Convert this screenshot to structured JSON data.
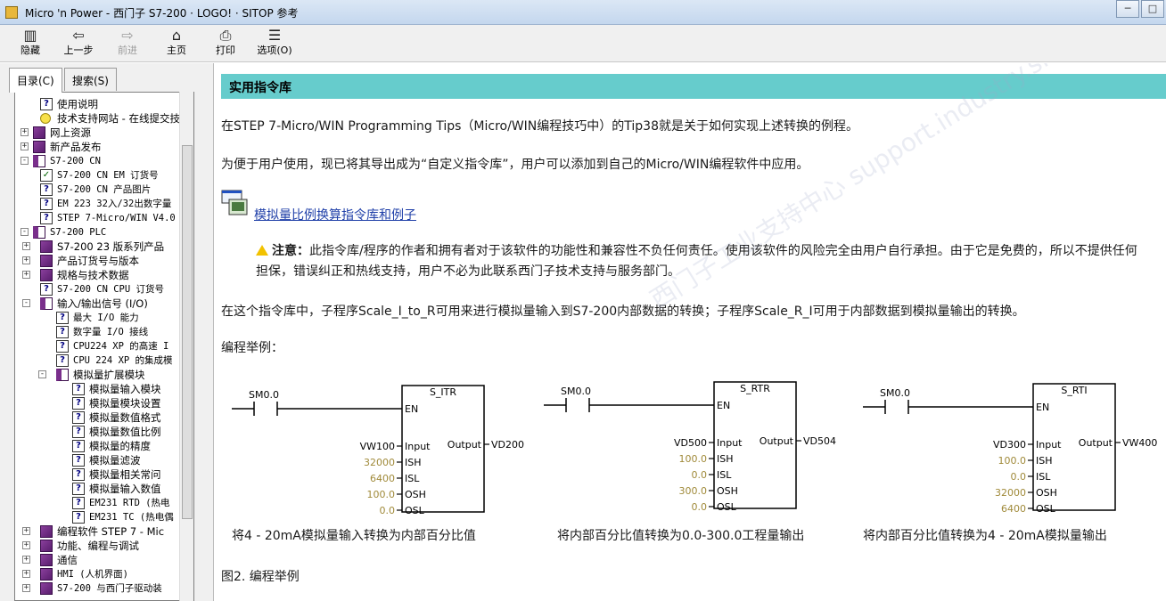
{
  "window": {
    "title": "Micro 'n Power - 西门子 S7-200 · LOGO! · SITOP 参考",
    "controls": [
      "minimize",
      "maximize"
    ]
  },
  "toolbar": {
    "buttons": [
      {
        "label": "隐藏",
        "icon": "hide-pane-icon",
        "enabled": true
      },
      {
        "label": "上一步",
        "icon": "back-arrow-icon",
        "enabled": true
      },
      {
        "label": "前进",
        "icon": "forward-arrow-icon",
        "enabled": false
      },
      {
        "label": "主页",
        "icon": "home-icon",
        "enabled": true
      },
      {
        "label": "打印",
        "icon": "printer-icon",
        "enabled": true
      },
      {
        "label": "选项(O)",
        "icon": "options-icon",
        "enabled": true
      }
    ]
  },
  "sidebar": {
    "tabs": [
      {
        "label": "目录(C)",
        "active": true
      },
      {
        "label": "搜索(S)",
        "active": false
      }
    ],
    "tree": [
      {
        "label": "使用说明",
        "icon": "page",
        "level": 1,
        "expander": "",
        "mono": false
      },
      {
        "label": "技术支持网站 - 在线提交技",
        "icon": "bulb",
        "level": 1,
        "expander": "",
        "mono": false
      },
      {
        "label": "网上资源",
        "icon": "book",
        "level": 0,
        "expander": "+",
        "mono": false
      },
      {
        "label": "新产品发布",
        "icon": "book",
        "level": 0,
        "expander": "+",
        "mono": false
      },
      {
        "label": "S7-200 CN",
        "icon": "bookopen",
        "level": 0,
        "expander": "-",
        "mono": true
      },
      {
        "label": "S7-200 CN EM 订货号",
        "icon": "check",
        "level": 1,
        "expander": "",
        "mono": true
      },
      {
        "label": "S7-200 CN 产品图片",
        "icon": "page",
        "level": 1,
        "expander": "",
        "mono": true
      },
      {
        "label": "EM 223 32入/32出数字量",
        "icon": "page",
        "level": 1,
        "expander": "",
        "mono": true
      },
      {
        "label": "STEP 7-Micro/WIN V4.0",
        "icon": "page",
        "level": 1,
        "expander": "",
        "mono": true
      },
      {
        "label": "S7-200 PLC",
        "icon": "bookopen",
        "level": 0,
        "expander": "-",
        "mono": true
      },
      {
        "label": "S7-200 23 版系列产品",
        "icon": "book",
        "level": 1,
        "expander": "+",
        "mono": false
      },
      {
        "label": "产品订货号与版本",
        "icon": "book",
        "level": 1,
        "expander": "+",
        "mono": false
      },
      {
        "label": "规格与技术数据",
        "icon": "book",
        "level": 1,
        "expander": "+",
        "mono": false
      },
      {
        "label": "S7-200 CN CPU 订货号",
        "icon": "page",
        "level": 1,
        "expander": "",
        "mono": true
      },
      {
        "label": "输入/输出信号 (I/O)",
        "icon": "bookopen",
        "level": 1,
        "expander": "-",
        "mono": false
      },
      {
        "label": "最大 I/O 能力",
        "icon": "page",
        "level": 2,
        "expander": "",
        "mono": true
      },
      {
        "label": "数字量 I/O 接线",
        "icon": "page",
        "level": 2,
        "expander": "",
        "mono": true
      },
      {
        "label": "CPU224 XP 的高速 I",
        "icon": "page",
        "level": 2,
        "expander": "",
        "mono": true
      },
      {
        "label": "CPU 224 XP 的集成模",
        "icon": "page",
        "level": 2,
        "expander": "",
        "mono": true
      },
      {
        "label": "模拟量扩展模块",
        "icon": "bookopen",
        "level": 2,
        "expander": "-",
        "mono": false
      },
      {
        "label": "模拟量输入模块",
        "icon": "page",
        "level": 3,
        "expander": "",
        "mono": false
      },
      {
        "label": "模拟量模块设置",
        "icon": "page",
        "level": 3,
        "expander": "",
        "mono": false
      },
      {
        "label": "模拟量数值格式",
        "icon": "page",
        "level": 3,
        "expander": "",
        "mono": false
      },
      {
        "label": "模拟量数值比例",
        "icon": "page",
        "level": 3,
        "expander": "",
        "mono": false
      },
      {
        "label": "模拟量的精度",
        "icon": "page",
        "level": 3,
        "expander": "",
        "mono": false
      },
      {
        "label": "模拟量滤波",
        "icon": "page",
        "level": 3,
        "expander": "",
        "mono": false
      },
      {
        "label": "模拟量相关常问",
        "icon": "page",
        "level": 3,
        "expander": "",
        "mono": false
      },
      {
        "label": "模拟量输入数值",
        "icon": "page",
        "level": 3,
        "expander": "",
        "mono": false
      },
      {
        "label": "EM231 RTD (热电",
        "icon": "page",
        "level": 3,
        "expander": "",
        "mono": true
      },
      {
        "label": "EM231 TC (热电偶",
        "icon": "page",
        "level": 3,
        "expander": "",
        "mono": true
      },
      {
        "label": "编程软件 STEP 7 - Mic",
        "icon": "book",
        "level": 1,
        "expander": "+",
        "mono": false
      },
      {
        "label": "功能、编程与调试",
        "icon": "book",
        "level": 1,
        "expander": "+",
        "mono": false
      },
      {
        "label": "通信",
        "icon": "book",
        "level": 1,
        "expander": "+",
        "mono": false
      },
      {
        "label": "HMI (人机界面)",
        "icon": "book",
        "level": 1,
        "expander": "+",
        "mono": true
      },
      {
        "label": "S7-200 与西门子驱动装",
        "icon": "book",
        "level": 1,
        "expander": "+",
        "mono": true
      }
    ]
  },
  "content": {
    "heading": "实用指令库",
    "para1": "在STEP 7-Micro/WIN Programming Tips（Micro/WIN编程技巧中）的Tip38就是关于如何实现上述转换的例程。",
    "para2": "为便于用户使用，现已将其导出成为“自定义指令库”，用户可以添加到自己的Micro/WIN编程软件中应用。",
    "link": "模拟量比例换算指令库和例子",
    "note_label": "注意：",
    "note_text": "此指令库/程序的作者和拥有者对于该软件的功能性和兼容性不负任何责任。使用该软件的风险完全由用户自行承担。由于它是免费的，所以不提供任何担保，错误纠正和热线支持，用户不必为此联系西门子技术支持与服务部门。",
    "para3": "在这个指令库中，子程序Scale_I_to_R可用来进行模拟量输入到S7-200内部数据的转换；子程序Scale_R_I可用于内部数据到模拟量输出的转换。",
    "para4": "编程举例：",
    "figure_caption": "图2. 编程举例",
    "watermark": "西门子工业支持中心 support.industry.siemens.com/cs"
  },
  "ladders": [
    {
      "contact": "SM0.0",
      "block": "S_ITR",
      "en": "EN",
      "output_pin": "Output",
      "output_value": "VD200",
      "inputs": [
        {
          "value": "VW100",
          "pin": "Input",
          "const": false
        },
        {
          "value": "32000",
          "pin": "ISH",
          "const": true
        },
        {
          "value": "6400",
          "pin": "ISL",
          "const": true
        },
        {
          "value": "100.0",
          "pin": "OSH",
          "const": true
        },
        {
          "value": "0.0",
          "pin": "OSL",
          "const": true
        }
      ],
      "caption": "将4 - 20mA模拟量输入转换为内部百分比值"
    },
    {
      "contact": "SM0.0",
      "block": "S_RTR",
      "en": "EN",
      "output_pin": "Output",
      "output_value": "VD504",
      "inputs": [
        {
          "value": "VD500",
          "pin": "Input",
          "const": false
        },
        {
          "value": "100.0",
          "pin": "ISH",
          "const": true
        },
        {
          "value": "0.0",
          "pin": "ISL",
          "const": true
        },
        {
          "value": "300.0",
          "pin": "OSH",
          "const": true
        },
        {
          "value": "0.0",
          "pin": "OSL",
          "const": true
        }
      ],
      "caption": "将内部百分比值转换为0.0-300.0工程量输出"
    },
    {
      "contact": "SM0.0",
      "block": "S_RTI",
      "en": "EN",
      "output_pin": "Output",
      "output_value": "VW400",
      "inputs": [
        {
          "value": "VD300",
          "pin": "Input",
          "const": false
        },
        {
          "value": "100.0",
          "pin": "ISH",
          "const": true
        },
        {
          "value": "0.0",
          "pin": "ISL",
          "const": true
        },
        {
          "value": "32000",
          "pin": "OSH",
          "const": true
        },
        {
          "value": "6400",
          "pin": "OSL",
          "const": true
        }
      ],
      "caption": "将内部百分比值转换为4 - 20mA模拟量输出"
    }
  ],
  "colors": {
    "heading_bar": "#66cccc",
    "link": "#1f3fa8",
    "constant_value": "#a08a3a",
    "warning": "#f2c200"
  }
}
